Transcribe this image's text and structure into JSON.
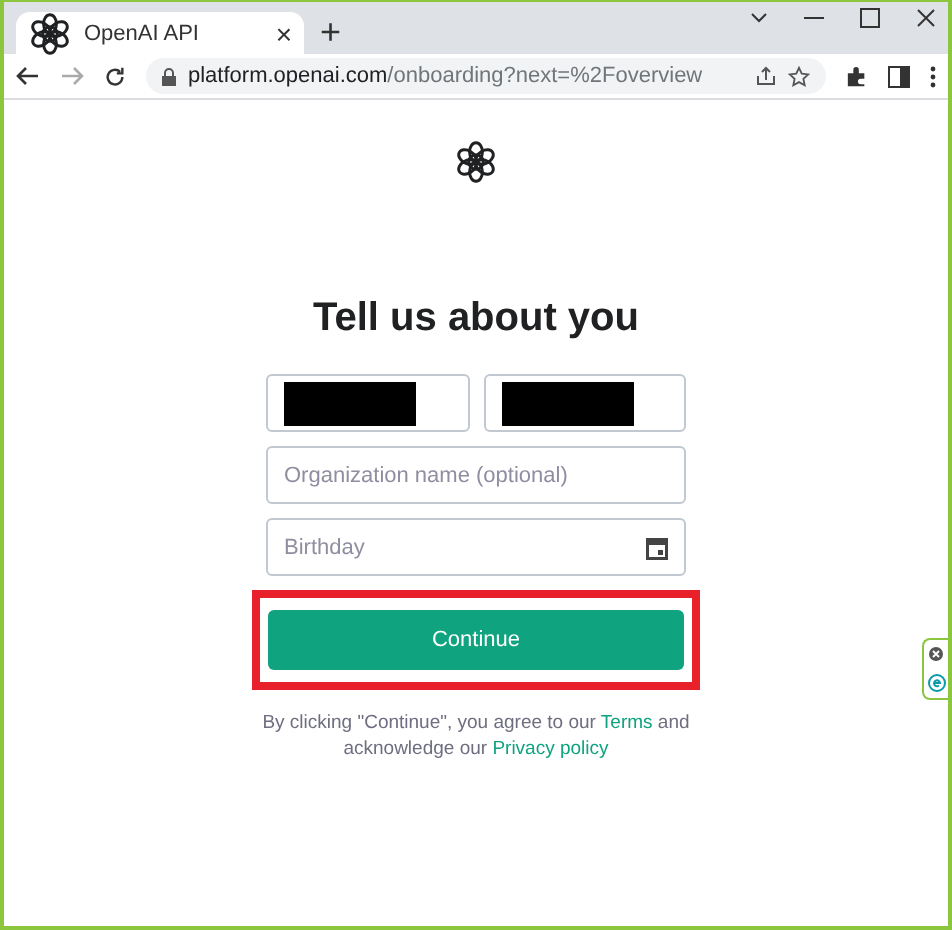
{
  "browser": {
    "tab": {
      "title": "OpenAI API",
      "close": "×"
    },
    "new_tab": "+",
    "url": {
      "host": "platform.openai.com",
      "path": "/onboarding?next=%2Foverview"
    }
  },
  "form": {
    "heading": "Tell us about you",
    "name_fields": [
      {
        "kind": "redacted"
      },
      {
        "kind": "redacted"
      }
    ],
    "fields": [
      {
        "kind": "text",
        "placeholder": "Organization name (optional)"
      },
      {
        "kind": "date",
        "placeholder": "Birthday"
      }
    ],
    "button": {
      "label": "Continue",
      "highlighted": true
    },
    "legal": {
      "before": "By clicking \"Continue\", you agree to our ",
      "terms": "Terms",
      "middle": " and acknowledge our ",
      "privacy": "Privacy policy"
    }
  }
}
